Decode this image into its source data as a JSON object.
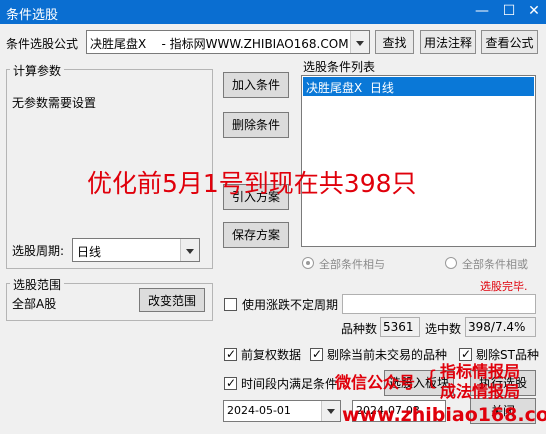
{
  "window": {
    "title": "条件选股"
  },
  "formula": {
    "label": "条件选股公式",
    "value": "决胜尾盘X    - 指标网WWW.ZHIBIAO168.COM"
  },
  "buttons": {
    "find": "查找",
    "usage_notes": "用法注释",
    "view_formula": "查看公式",
    "add_condition": "加入条件",
    "delete_condition": "删除条件",
    "import_plan": "引入方案",
    "save_plan": "保存方案",
    "change_range": "改变范围",
    "select_to_block": "选股入板块",
    "execute_select": "执行选股",
    "close": "关闭"
  },
  "params": {
    "group_title": "计算参数",
    "note": "无参数需要设置"
  },
  "period": {
    "label": "选股周期:",
    "value": "日线"
  },
  "condition_list": {
    "label": "选股条件列表",
    "items": [
      "决胜尾盘X  日线"
    ]
  },
  "logic": {
    "and_label": "全部条件相与",
    "or_label": "全部条件相或"
  },
  "status": "选股完毕.",
  "range": {
    "group_title": "选股范围",
    "value": "全部A股"
  },
  "unfixed_period": {
    "label": "使用涨跌不定周期",
    "value": ""
  },
  "counts": {
    "stock_count_label": "品种数",
    "stock_count": "5361",
    "selected_label": "选中数",
    "selected": "398/7.4%"
  },
  "options": {
    "prior_adjust": "前复权数据",
    "exclude_untraded": "剔除当前未交易的品种",
    "exclude_st": "剔除ST品种",
    "time_range": "时间段内满足条件"
  },
  "dates": {
    "start": "2024-05-01",
    "end": "2024-07-03"
  },
  "overlays": {
    "headline": "优化前5月1号到现在共398只",
    "wechat": "微信公众号",
    "brand1": "指标情报局",
    "brand2": "成法情报局",
    "site": "www.zhibiao168.com"
  },
  "colors": {
    "titlebar": "#0a6ed1",
    "selection": "#0a78d7",
    "overlay_red": "#e0000b"
  }
}
